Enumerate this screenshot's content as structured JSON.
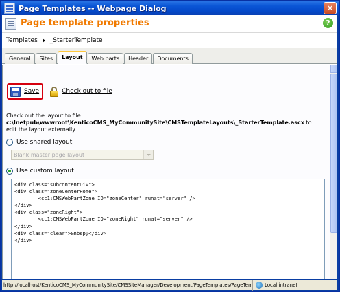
{
  "window": {
    "title": "Page Templates -- Webpage Dialog",
    "close_label": "✕"
  },
  "header": {
    "title": "Page template properties",
    "help_label": "?"
  },
  "breadcrumb": {
    "root": "Templates",
    "current": "_StarterTemplate"
  },
  "tabs": [
    {
      "label": "General"
    },
    {
      "label": "Sites"
    },
    {
      "label": "Layout"
    },
    {
      "label": "Web parts"
    },
    {
      "label": "Header"
    },
    {
      "label": "Documents"
    }
  ],
  "active_tab": "Layout",
  "toolbar": {
    "save_label": "Save",
    "checkout_label": "Check out to file"
  },
  "info": {
    "line1": "Check out the layout to file",
    "path": "c:\\Inetpub\\wwwroot\\KenticoCMS_MyCommunitySite\\CMSTemplateLayouts\\_StarterTemplate.ascx",
    "path_suffix": " to",
    "line3": "edit the layout externally."
  },
  "layout_options": {
    "shared_label": "Use shared layout",
    "shared_checked": false,
    "shared_select_value": "Blank master page layout",
    "custom_label": "Use custom layout",
    "custom_checked": true
  },
  "custom_layout_code": "<div class=\"subcontentDiv\">\n<div class=\"zoneCenterHome\">\n        <cc1:CMSWebPartZone ID=\"zoneCenter\" runat=\"server\" />\n</div>\n<div class=\"zoneRight\">\n        <cc1:CMSWebPartZone ID=\"zoneRight\" runat=\"server\" />\n</div>\n<div class=\"clear\">&nbsp;</div>\n</div>",
  "statusbar": {
    "url": "http://localhost/KenticoCMS_MyCommunitySite/CMSSiteManager/Development/PageTemplates/PageTemp",
    "zone": "Local intranet"
  },
  "colors": {
    "header_title": "#f07a00",
    "save_highlight": "#d5000f",
    "titlebar": "#0b56d6"
  }
}
